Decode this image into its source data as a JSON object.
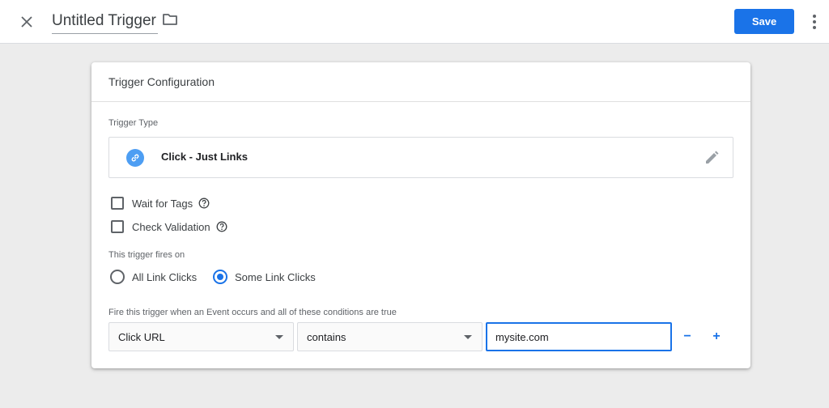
{
  "header": {
    "title": "Untitled Trigger",
    "save_label": "Save",
    "close_icon": "close-icon",
    "folder_icon": "folder-icon",
    "more_icon": "more-vert-icon"
  },
  "card": {
    "title": "Trigger Configuration",
    "trigger_type_label": "Trigger Type",
    "trigger_type_name": "Click - Just Links",
    "trigger_type_icon": "link-icon",
    "options": [
      {
        "label": "Wait for Tags",
        "checked": false
      },
      {
        "label": "Check Validation",
        "checked": false
      }
    ],
    "fires_on_label": "This trigger fires on",
    "fires_on_options": [
      {
        "label": "All Link Clicks",
        "selected": false
      },
      {
        "label": "Some Link Clicks",
        "selected": true
      }
    ],
    "condition_label": "Fire this trigger when an Event occurs and all of these conditions are true",
    "condition": {
      "variable": "Click URL",
      "operator": "contains",
      "value": "mysite.com"
    },
    "remove_label": "−",
    "add_label": "+"
  },
  "colors": {
    "accent": "#1a73e8",
    "link_icon_bg": "#4d9ef3",
    "background": "#ececec"
  }
}
